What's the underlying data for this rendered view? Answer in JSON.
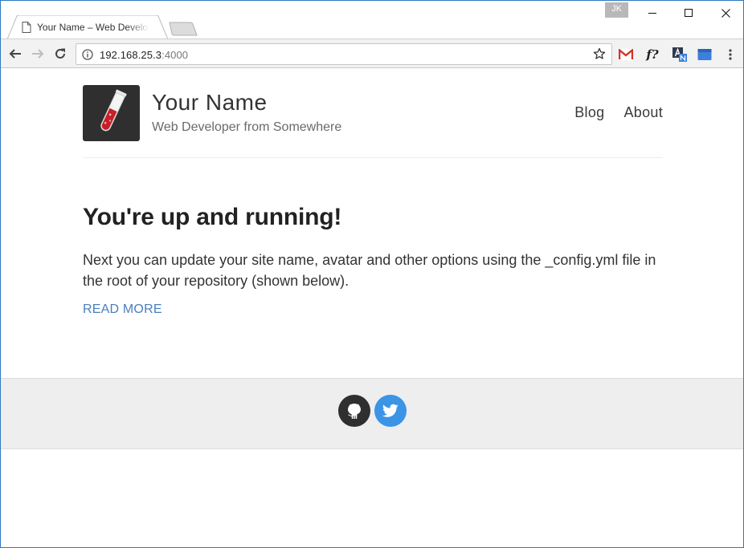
{
  "browser": {
    "tab_title": "Your Name – Web Developer from Somewhere",
    "profile_badge": "JK",
    "address": {
      "host": "192.168.25.3",
      "port": ":4000"
    },
    "icons": {
      "back": "arrow-left-icon",
      "forward": "arrow-right-icon",
      "reload": "reload-icon",
      "info": "info-icon",
      "bookmark": "star-icon",
      "menu": "kebab-menu-icon"
    },
    "extensions": [
      "gmail-icon",
      "font-finder-icon",
      "translate-icon",
      "cast-icon"
    ],
    "extension_labels": {
      "font_finder": "f?"
    },
    "accent": "#2b79c2"
  },
  "site": {
    "name": "Your Name",
    "description": "Web Developer from Somewhere",
    "nav": [
      {
        "label": "Blog"
      },
      {
        "label": "About"
      }
    ]
  },
  "post": {
    "title": "You're up and running!",
    "excerpt": "Next you can update your site name, avatar and other options using the _config.yml file in the root of your repository (shown below).",
    "read_more": "READ MORE",
    "link_color": "#4a7fbc"
  },
  "footer": {
    "social": [
      {
        "name": "github-icon",
        "color": "#2f2f2f"
      },
      {
        "name": "twitter-icon",
        "color": "#3b94e6"
      }
    ]
  }
}
